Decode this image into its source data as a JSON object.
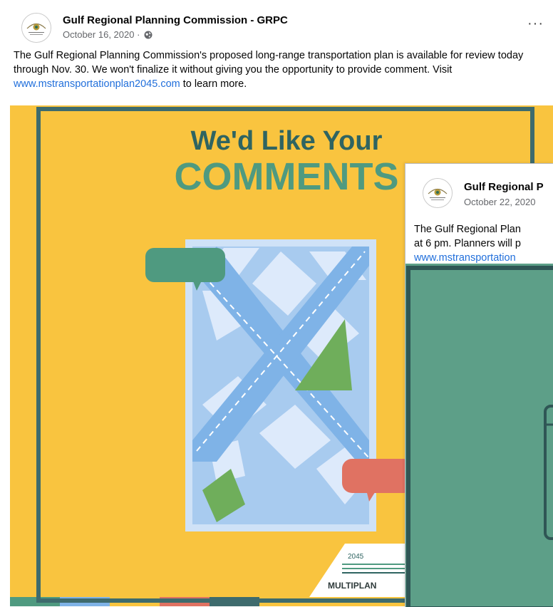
{
  "post1": {
    "author": "Gulf Regional Planning Commission - GRPC",
    "date": "October 16, 2020 ·",
    "privacy_icon": "globe-icon",
    "more_icon": "more-options-icon",
    "more_label": "···",
    "text_before_link": "The Gulf Regional Planning Commission's proposed long-range transportation plan is available for review today through Nov. 30. We won't finalize it without giving you the opportunity to provide comment. Visit ",
    "link": "www.mstransportationplan2045.com",
    "text_after_link": " to learn more.",
    "image": {
      "headline_line1": "We'd Like Your",
      "headline_line2": "COMMENTS",
      "logo_year": "2045",
      "logo_name": "MULTIPLAN"
    }
  },
  "post2": {
    "author": "Gulf Regional P",
    "date": "October 22, 2020",
    "line1": "The Gulf Regional Plan",
    "line2": "at 6 pm. Planners will p",
    "link": "www.mstransportation"
  },
  "colors": {
    "poster_yellow": "#f9c43f",
    "poster_border": "#3e6b6d",
    "headline_dark": "#2f6461",
    "headline_green": "#4f9a80",
    "map_blue": "#cfe2f7",
    "road_blue": "#7fb3e7",
    "bubble_green": "#4f9a80",
    "bubble_red": "#e07262",
    "teal_panel": "#5d9f88",
    "link_blue": "#216fdb"
  }
}
